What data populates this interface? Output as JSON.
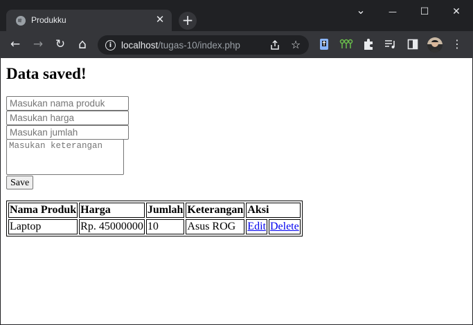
{
  "browser": {
    "tab_title": "Produkku",
    "tab_close": "✕",
    "new_tab": "+",
    "url_host": "localhost",
    "url_path": "/tugas-10/index.php",
    "window_controls": {
      "dropdown": "⌄",
      "minimize": "—",
      "maximize": "☐",
      "close": "✕"
    },
    "nav": {
      "back": "←",
      "forward": "→",
      "reload": "↻",
      "home": "⌂"
    },
    "toolbar_icons": [
      "share-icon",
      "bookmark-star-icon",
      "extension-clipper-icon",
      "extension-tree-icon",
      "extensions-puzzle-icon",
      "reading-list-icon",
      "side-panel-icon",
      "profile-avatar",
      "menu-icon"
    ]
  },
  "page": {
    "heading": "Data saved!",
    "form": {
      "nama_placeholder": "Masukan nama produk",
      "harga_placeholder": "Masukan harga",
      "jumlah_placeholder": "Masukan jumlah",
      "keterangan_placeholder": "Masukan keterangan",
      "save_label": "Save"
    },
    "table": {
      "headers": [
        "Nama Produk",
        "Harga",
        "Jumlah",
        "Keterangan",
        "Aksi"
      ],
      "rows": [
        {
          "nama": "Laptop",
          "harga": "Rp. 45000000",
          "jumlah": "10",
          "keterangan": "Asus ROG",
          "edit": "Edit",
          "delete": "Delete"
        }
      ]
    }
  }
}
